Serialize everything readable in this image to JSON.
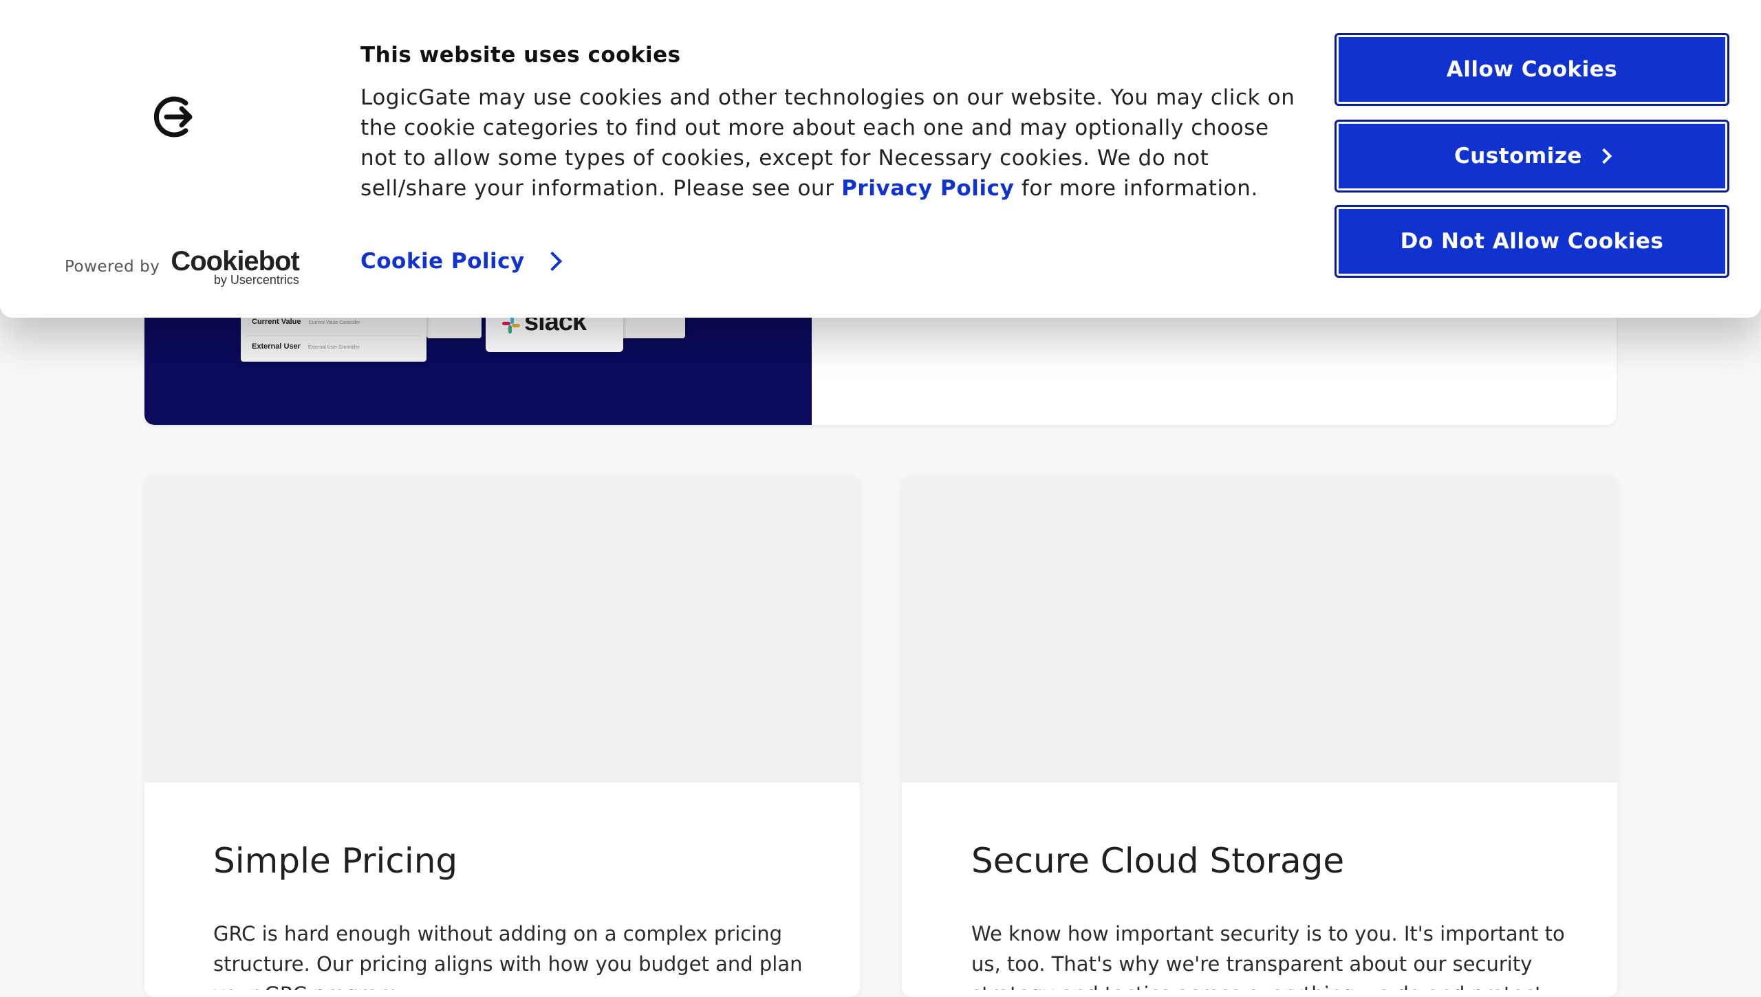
{
  "cookie_banner": {
    "title": "This website uses cookies",
    "body_before_link": "LogicGate may use cookies and other technologies on our website. You may click on the cookie categories to find out more about each one and may optionally choose not to allow some types of cookies, except for Necessary cookies.  We do not sell/share your information. Please see our ",
    "privacy_link": "Privacy Policy",
    "body_after_link": " for more information.",
    "cookie_policy_link": "Cookie Policy",
    "powered_by": "Powered by",
    "brand_name": "Cookiebot",
    "brand_sub": "by Usercentrics",
    "buttons": {
      "allow": "Allow Cookies",
      "customize": "Customize",
      "deny": "Do Not Allow Cookies"
    },
    "colors": {
      "accent": "#1032cf"
    }
  },
  "hero": {
    "mini_card": {
      "row1_label": "Current Value",
      "row1_sub": "Current Value Controller",
      "row2_label": "External User",
      "row2_sub": "External User Controller"
    },
    "slack_word": "slack",
    "colors": {
      "dark_panel": "#0b0a5c"
    }
  },
  "features": [
    {
      "title": "Simple Pricing",
      "text": "GRC is hard enough without adding on a complex pricing structure. Our pricing aligns with how you budget and plan your GRC program."
    },
    {
      "title": "Secure Cloud Storage",
      "text": "We know how important security is to you. It's important to us, too. That's why we're transparent about our security strategy and tactics across everything we do and protect."
    }
  ]
}
